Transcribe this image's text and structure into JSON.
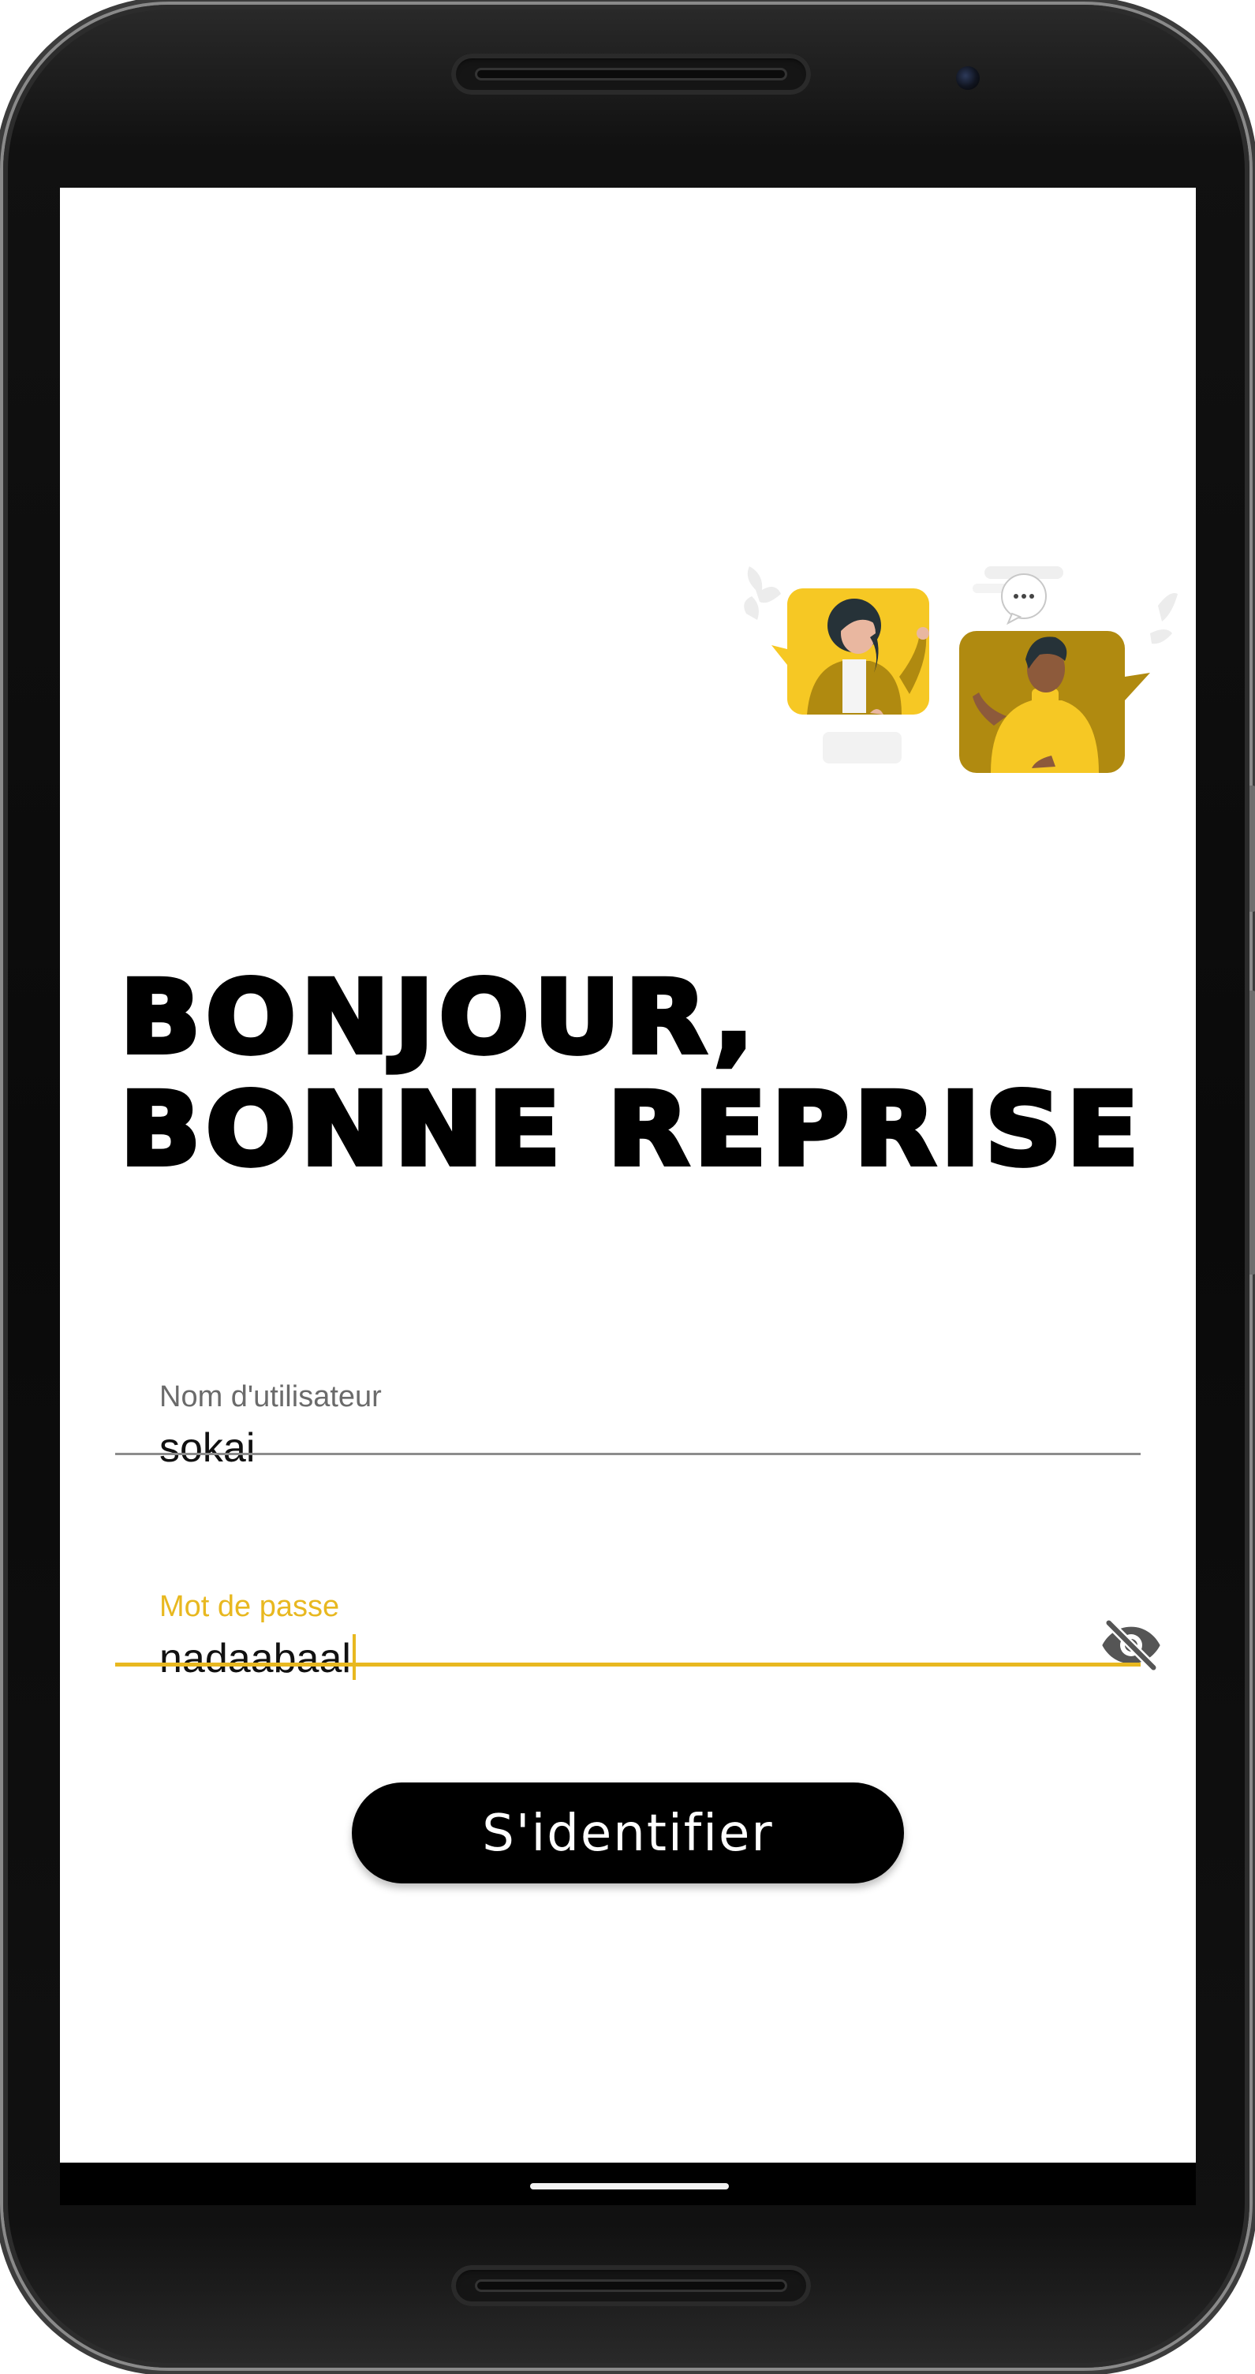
{
  "login": {
    "title_line1": "BONJOUR,",
    "title_line2": "BONNE REPRISE",
    "username": {
      "label": "Nom d'utilisateur",
      "value": "sokai"
    },
    "password": {
      "label": "Mot de passe",
      "value": "nadaabaal",
      "visibility_icon": "eye-off-icon"
    },
    "submit_label": "S'identifier"
  },
  "colors": {
    "accent": "#e8b820",
    "text": "#111111",
    "label_inactive": "#6b6b6b",
    "underline_inactive": "#8c8c8c",
    "button": "#000000",
    "illustration_yellow": "#f6c824",
    "illustration_olive": "#b08a10"
  }
}
